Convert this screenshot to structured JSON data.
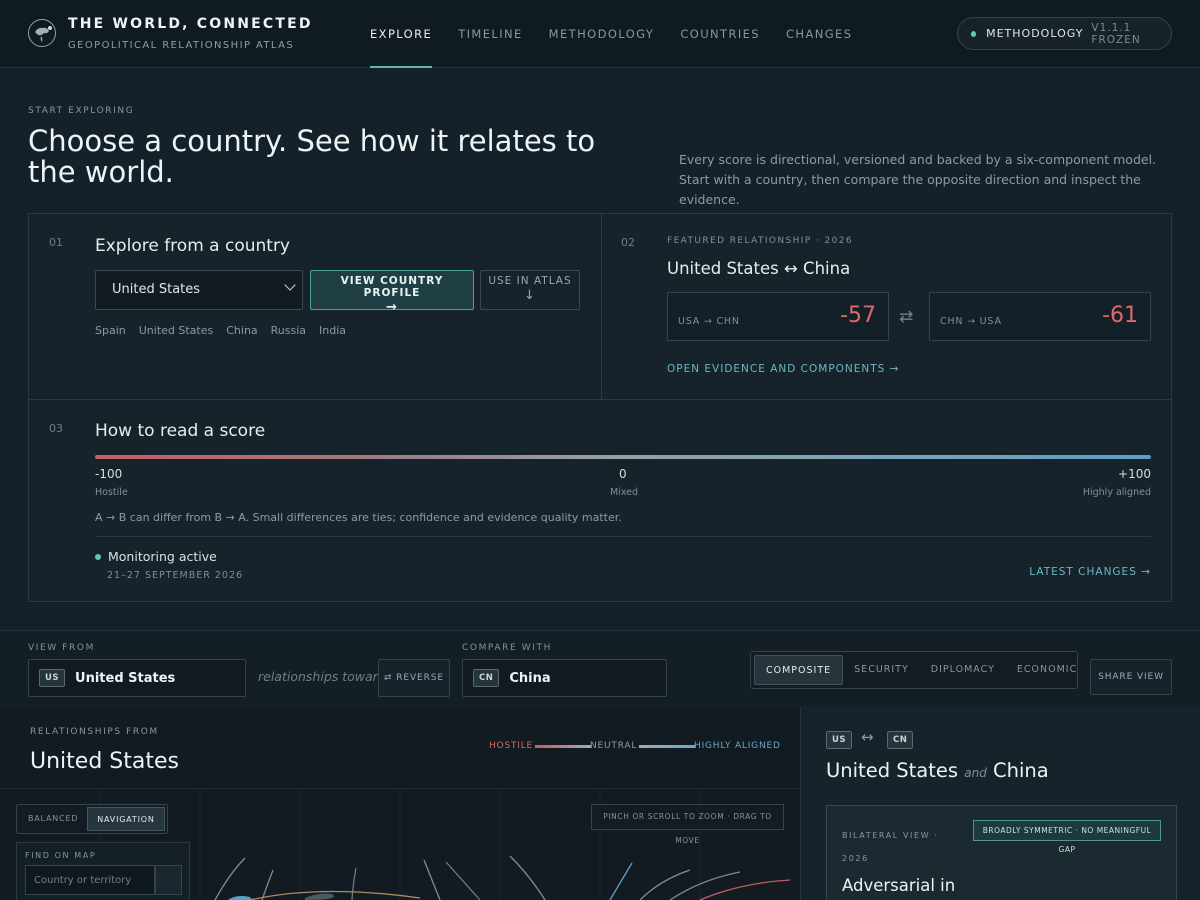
{
  "header": {
    "brand_title": "THE WORLD, CONNECTED",
    "brand_subtitle": "GEOPOLITICAL RELATIONSHIP ATLAS",
    "nav": [
      "EXPLORE",
      "TIMELINE",
      "METHODOLOGY",
      "COUNTRIES",
      "CHANGES"
    ],
    "active_nav": "EXPLORE",
    "methodology_label": "METHODOLOGY",
    "methodology_version": "V1.1.1 FROZEN"
  },
  "intro": {
    "eyebrow": "START EXPLORING",
    "headline": "Choose a country. See how it relates to the world.",
    "description": "Every score is directional, versioned and backed by a six-component model. Start with a country, then compare the opposite direction and inspect the evidence."
  },
  "explore": {
    "number": "01",
    "title": "Explore from a country",
    "selected_country": "United States",
    "view_profile_label": "VIEW COUNTRY PROFILE",
    "view_profile_arrow": "→",
    "use_atlas_label": "USE IN ATLAS",
    "use_atlas_arrow": "↓",
    "quick_picks": [
      "Spain",
      "United States",
      "China",
      "Russia",
      "India"
    ]
  },
  "featured": {
    "number": "02",
    "eyebrow": "FEATURED RELATIONSHIP · 2026",
    "title": "United States ↔ China",
    "a_to_b_label": "USA → CHN",
    "a_to_b_score": "-57",
    "b_to_a_label": "CHN → USA",
    "b_to_a_score": "-61",
    "swap_symbol": "⇄",
    "evidence_link": "OPEN EVIDENCE AND COMPONENTS →"
  },
  "scale": {
    "number": "03",
    "title": "How to read a score",
    "ticks": [
      {
        "value": "-100",
        "label": "Hostile"
      },
      {
        "value": "0",
        "label": "Mixed"
      },
      {
        "value": "+100",
        "label": "Highly aligned"
      }
    ],
    "note": "A → B can differ from B → A. Small differences are ties; confidence and evidence quality matter.",
    "monitoring_label": "Monitoring active",
    "monitoring_dates": "21–27 SEPTEMBER 2026",
    "latest_changes_link": "LATEST CHANGES →"
  },
  "controls": {
    "view_from_label": "VIEW FROM",
    "view_from_code": "US",
    "view_from_country": "United States",
    "relationships_toward": "relationships toward",
    "reverse_label": "⇄ REVERSE",
    "compare_with_label": "COMPARE WITH",
    "compare_code": "CN",
    "compare_country": "China",
    "segments": [
      "COMPOSITE",
      "SECURITY",
      "DIPLOMACY",
      "ECONOMIC"
    ],
    "active_segment": "COMPOSITE",
    "share_label": "SHARE VIEW"
  },
  "map_panel": {
    "eyebrow": "RELATIONSHIPS FROM",
    "title": "United States",
    "legend": {
      "hostile": "HOSTILE",
      "neutral": "NEUTRAL",
      "aligned": "HIGHLY ALIGNED"
    },
    "modes": [
      "BALANCED",
      "NAVIGATION"
    ],
    "active_mode": "NAVIGATION",
    "zoom_hint": "PINCH OR SCROLL TO ZOOM · DRAG TO MOVE",
    "find_label": "FIND ON MAP",
    "find_placeholder": "Country or territory"
  },
  "pair_panel": {
    "code_a": "US",
    "code_b": "CN",
    "country_a": "United States",
    "connector": "and",
    "country_b": "China",
    "bilateral_eyebrow": "BILATERAL VIEW ·",
    "bilateral_year": "2026",
    "symmetry_badge": "BROADLY SYMMETRIC · NO MEANINGFUL GAP",
    "summary": "Adversarial in"
  },
  "colors": {
    "accent": "#5fb8b0",
    "hostile": "#e0676a",
    "aligned": "#5b9fc7",
    "link": "#69b9c4"
  }
}
